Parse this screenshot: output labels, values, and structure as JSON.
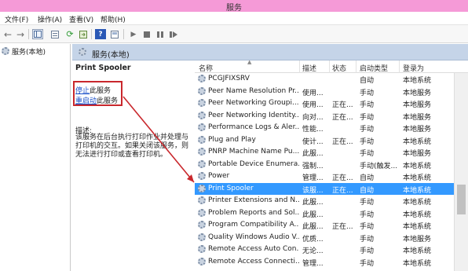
{
  "window": {
    "title": "服务"
  },
  "menu": [
    "文件(F)",
    "操作(A)",
    "查看(V)",
    "帮助(H)"
  ],
  "toolbar_icons": [
    "back-icon",
    "forward-icon",
    "show-hide-tree-icon",
    "properties-icon",
    "refresh-icon",
    "export-icon",
    "help-icon",
    "view-icon",
    "play-icon",
    "stop-icon",
    "pause-icon",
    "restart-icon"
  ],
  "tree": {
    "root_label": "服务(本地)"
  },
  "content": {
    "header": "服务(本地)"
  },
  "detail": {
    "service_name": "Print Spooler",
    "stop_link": "停止",
    "stop_suffix": "此服务",
    "restart_link": "重启动",
    "restart_suffix": "此服务",
    "desc_label": "描述:",
    "desc_text": "该服务在后台执行打印作业并处理与打印机的交互。如果关闭该服务，则无法进行打印或查看打印机。"
  },
  "columns": {
    "name": "名称",
    "desc": "描述",
    "status": "状态",
    "start": "启动类型",
    "logon": "登录为"
  },
  "services": [
    {
      "name": "PCGJFIXSRV",
      "desc": "",
      "status": "",
      "start": "自动",
      "logon": "本地系统"
    },
    {
      "name": "Peer Name Resolution Pr...",
      "desc": "使用...",
      "status": "",
      "start": "手动",
      "logon": "本地服务"
    },
    {
      "name": "Peer Networking Groupi...",
      "desc": "使用...",
      "status": "正在...",
      "start": "手动",
      "logon": "本地服务"
    },
    {
      "name": "Peer Networking Identity...",
      "desc": "向对...",
      "status": "正在...",
      "start": "手动",
      "logon": "本地服务"
    },
    {
      "name": "Performance Logs & Aler...",
      "desc": "性能...",
      "status": "",
      "start": "手动",
      "logon": "本地服务"
    },
    {
      "name": "Plug and Play",
      "desc": "使计...",
      "status": "正在...",
      "start": "手动",
      "logon": "本地系统"
    },
    {
      "name": "PNRP Machine Name Pu...",
      "desc": "此服...",
      "status": "",
      "start": "手动",
      "logon": "本地服务"
    },
    {
      "name": "Portable Device Enumera...",
      "desc": "强制...",
      "status": "",
      "start": "手动(触发...",
      "logon": "本地系统"
    },
    {
      "name": "Power",
      "desc": "管理...",
      "status": "正在...",
      "start": "自动",
      "logon": "本地系统"
    },
    {
      "name": "Print Spooler",
      "desc": "该服...",
      "status": "正在...",
      "start": "自动",
      "logon": "本地系统"
    },
    {
      "name": "Printer Extensions and N...",
      "desc": "此服...",
      "status": "",
      "start": "手动",
      "logon": "本地系统"
    },
    {
      "name": "Problem Reports and Sol...",
      "desc": "此服...",
      "status": "",
      "start": "手动",
      "logon": "本地系统"
    },
    {
      "name": "Program Compatibility A...",
      "desc": "此服...",
      "status": "正在...",
      "start": "手动",
      "logon": "本地系统"
    },
    {
      "name": "Quality Windows Audio V...",
      "desc": "优质...",
      "status": "",
      "start": "手动",
      "logon": "本地服务"
    },
    {
      "name": "Remote Access Auto Con...",
      "desc": "无论...",
      "status": "",
      "start": "手动",
      "logon": "本地系统"
    },
    {
      "name": "Remote Access Connecti...",
      "desc": "管理...",
      "status": "",
      "start": "手动",
      "logon": "本地系统"
    }
  ],
  "selected_service": "Print Spooler",
  "colors": {
    "title_bar": "#f59ad7",
    "selection": "#3399ff",
    "highlight_box": "#c9282d",
    "header_band": "#c5d4e8"
  }
}
